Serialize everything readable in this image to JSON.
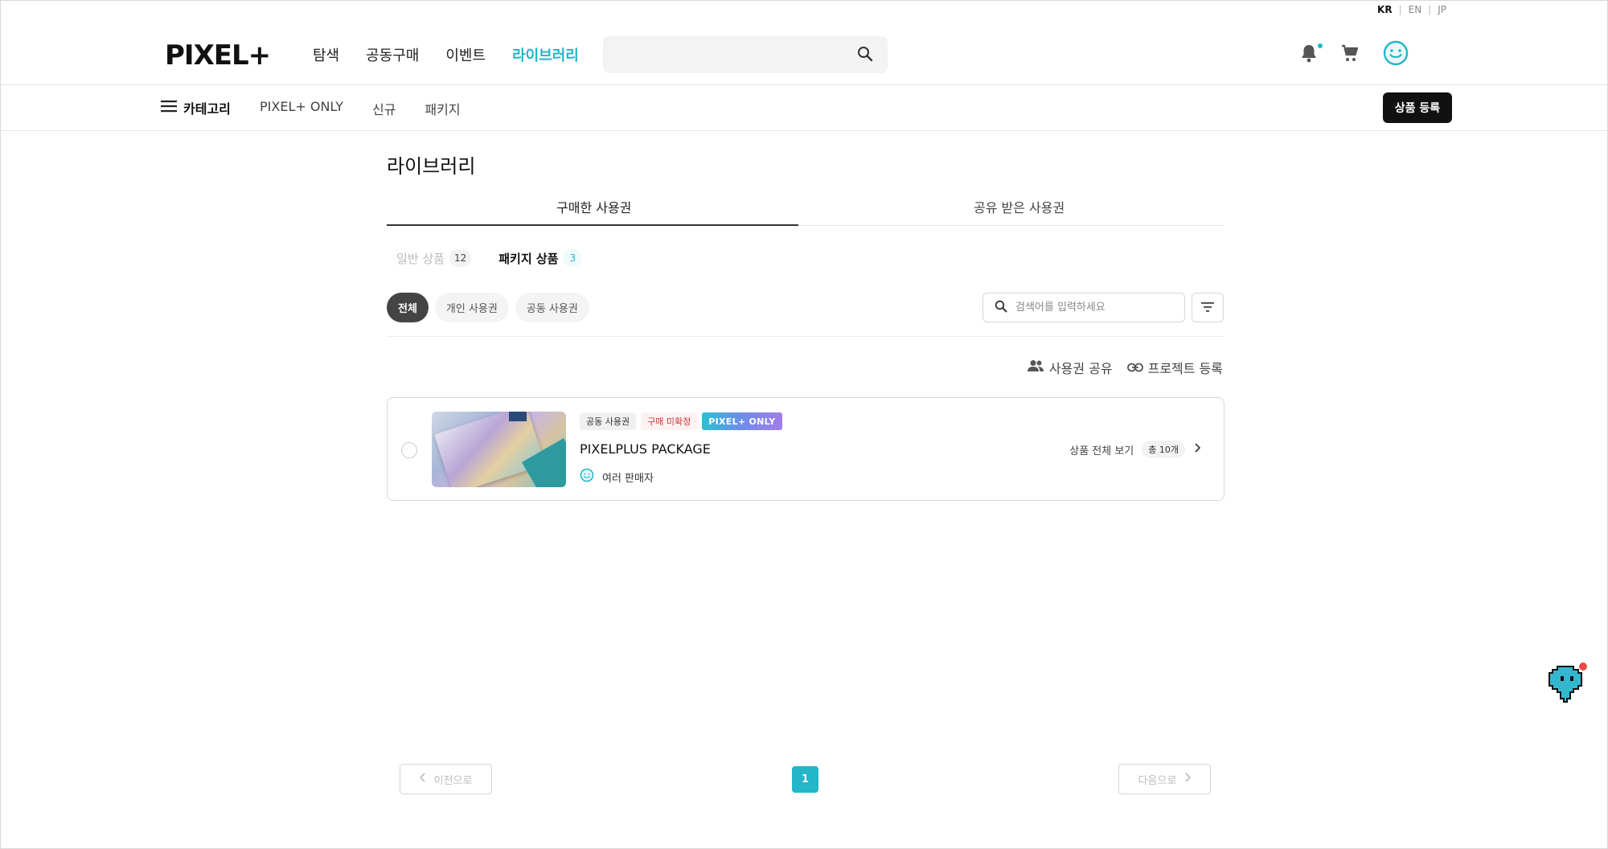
{
  "languages": [
    {
      "label": "KR",
      "active": true
    },
    {
      "label": "EN",
      "active": false
    },
    {
      "label": "JP",
      "active": false
    }
  ],
  "header": {
    "logo": "PIXEL+",
    "nav": [
      {
        "label": "탐색",
        "active": false
      },
      {
        "label": "공동구매",
        "active": false
      },
      {
        "label": "이벤트",
        "active": false
      },
      {
        "label": "라이브러리",
        "active": true
      }
    ],
    "search_placeholder": ""
  },
  "category_bar": {
    "menu_label": "카테고리",
    "links": [
      "PIXEL+ ONLY",
      "신규",
      "패키지"
    ],
    "register_button": "상품 등록"
  },
  "library": {
    "title": "라이브러리",
    "tabs": [
      {
        "label": "구매한 사용권",
        "active": true
      },
      {
        "label": "공유 받은 사용권",
        "active": false
      }
    ],
    "subtabs": [
      {
        "label": "일반 상품",
        "count": "12",
        "active": false
      },
      {
        "label": "패키지 상품",
        "count": "3",
        "active": true
      }
    ],
    "chips": [
      {
        "label": "전체",
        "active": true
      },
      {
        "label": "개인 사용권",
        "active": false
      },
      {
        "label": "공동 사용권",
        "active": false
      }
    ],
    "search_placeholder": "검색어를 입력하세요",
    "actions": {
      "share": "사용권 공유",
      "project": "프로젝트 등록"
    },
    "items": [
      {
        "badges": [
          "공동 사용권",
          "구매 미확정",
          "PIXEL+ ONLY"
        ],
        "title": "PIXELPLUS PACKAGE",
        "seller": "여러 판매자",
        "view_all": "상품 전체 보기",
        "total": "총 10개"
      }
    ]
  },
  "pagination": {
    "prev": "이전으로",
    "next": "다음으로",
    "current": "1"
  },
  "colors": {
    "accent": "#22b6c8",
    "dark": "#111111"
  }
}
